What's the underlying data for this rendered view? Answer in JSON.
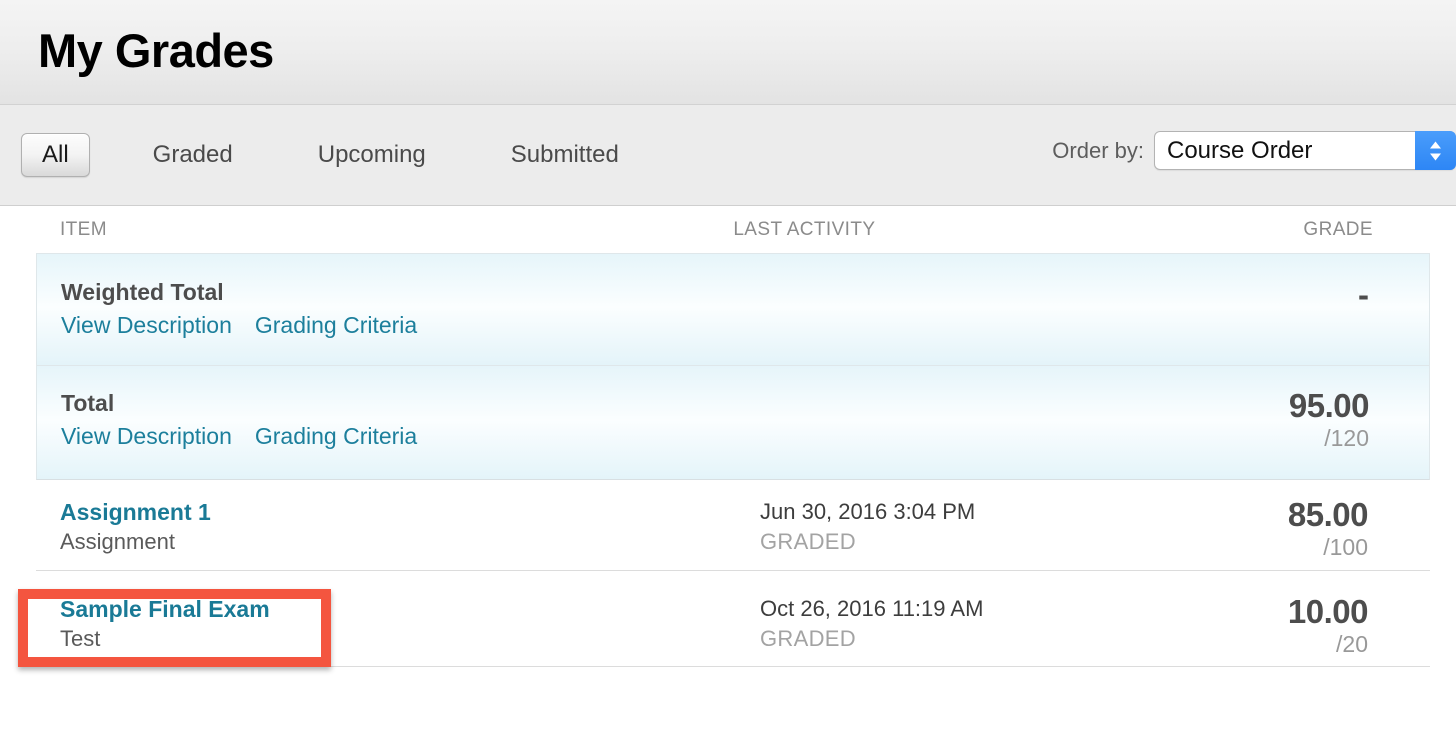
{
  "header": {
    "title": "My Grades"
  },
  "toolbar": {
    "tabs": [
      {
        "label": "All",
        "selected": true
      },
      {
        "label": "Graded",
        "selected": false
      },
      {
        "label": "Upcoming",
        "selected": false
      },
      {
        "label": "Submitted",
        "selected": false
      }
    ],
    "order_by": {
      "label": "Order by:",
      "value": "Course Order",
      "stepper_icon": "chevron-up-down-icon",
      "accent_color": "#2d86f5"
    }
  },
  "table": {
    "columns": {
      "item": "ITEM",
      "last_activity": "LAST ACTIVITY",
      "grade": "GRADE"
    },
    "rows": [
      {
        "type": "total",
        "title": "Weighted Total",
        "links": [
          "View Description",
          "Grading Criteria"
        ],
        "last_activity": "",
        "status": "",
        "score": "-",
        "out_of": ""
      },
      {
        "type": "total",
        "title": "Total",
        "links": [
          "View Description",
          "Grading Criteria"
        ],
        "last_activity": "",
        "status": "",
        "score": "95.00",
        "out_of": "/120"
      },
      {
        "type": "item",
        "title": "Assignment 1",
        "subtitle": "Assignment",
        "last_activity": "Jun 30, 2016 3:04 PM",
        "status": "GRADED",
        "score": "85.00",
        "out_of": "/100"
      },
      {
        "type": "item",
        "title": "Sample Final Exam",
        "subtitle": "Test",
        "last_activity": "Oct 26, 2016 11:19 AM",
        "status": "GRADED",
        "score": "10.00",
        "out_of": "/20",
        "highlighted": true
      }
    ]
  },
  "annotation": {
    "color": "#f4553f",
    "target": "Sample Final Exam"
  }
}
